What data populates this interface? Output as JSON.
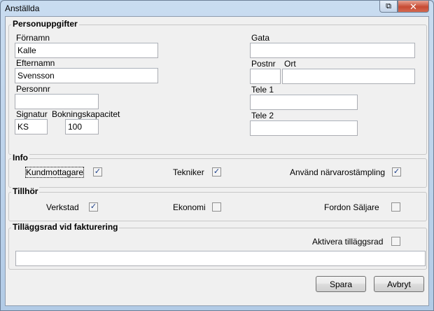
{
  "window": {
    "title": "Anställda",
    "close_glyph": "✕",
    "aux_glyph": "⧉"
  },
  "personuppgifter": {
    "legend": "Personuppgifter",
    "fornamn": {
      "label": "Förnamn",
      "value": "Kalle"
    },
    "efternamn": {
      "label": "Efternamn",
      "value": "Svensson"
    },
    "personnr": {
      "label": "Personnr",
      "value": ""
    },
    "signatur": {
      "label": "Signatur",
      "value": "KS"
    },
    "bokningskapacitet": {
      "label": "Bokningskapacitet",
      "value": "100"
    },
    "gata": {
      "label": "Gata",
      "value": ""
    },
    "postnr": {
      "label": "Postnr",
      "value": ""
    },
    "ort": {
      "label": "Ort",
      "value": ""
    },
    "tele1": {
      "label": "Tele 1",
      "value": ""
    },
    "tele2": {
      "label": "Tele 2",
      "value": ""
    }
  },
  "info": {
    "legend": "Info",
    "kundmottagare": {
      "label": "Kundmottagare",
      "checked": true
    },
    "tekniker": {
      "label": "Tekniker",
      "checked": true
    },
    "narvaro": {
      "label": "Använd närvarostämpling",
      "checked": true
    }
  },
  "tillhor": {
    "legend": "Tillhör",
    "verkstad": {
      "label": "Verkstad",
      "checked": true
    },
    "ekonomi": {
      "label": "Ekonomi",
      "checked": false
    },
    "fordon": {
      "label": "Fordon Säljare",
      "checked": false
    }
  },
  "tillaggsrad": {
    "legend": "Tilläggsrad vid fakturering",
    "aktivera": {
      "label": "Aktivera tilläggsrad",
      "checked": false
    },
    "text": {
      "value": ""
    }
  },
  "buttons": {
    "save": "Spara",
    "cancel": "Avbryt"
  },
  "check_glyph": "✓"
}
